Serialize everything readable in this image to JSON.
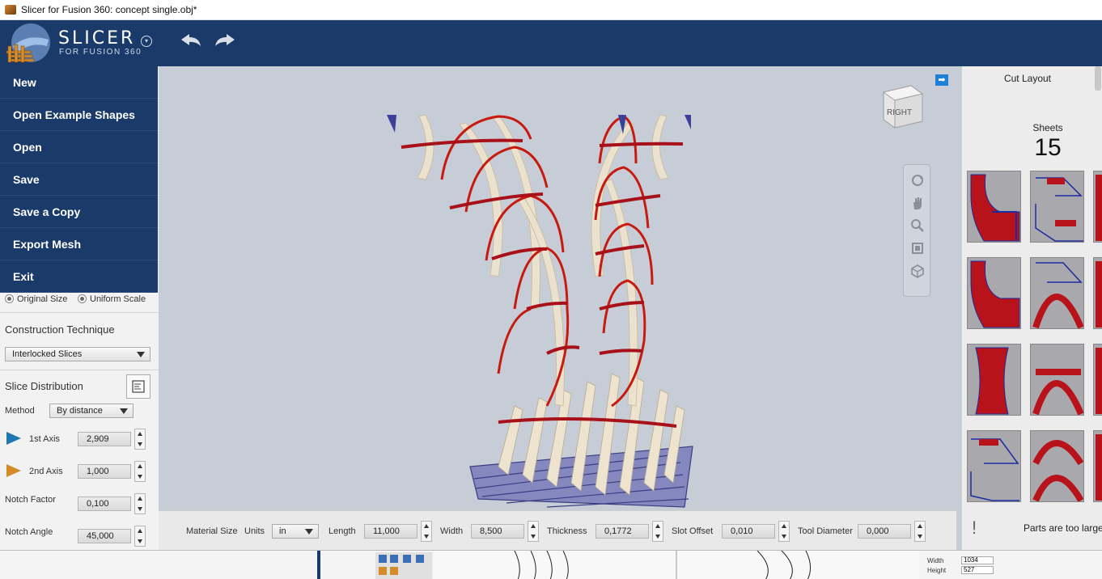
{
  "window": {
    "title": "Slicer for Fusion 360: concept single.obj*"
  },
  "header": {
    "logo_title": "SLICER",
    "logo_subtitle": "FOR FUSION 360"
  },
  "menu": {
    "items": [
      {
        "label": "New"
      },
      {
        "label": "Open Example Shapes"
      },
      {
        "label": "Open"
      },
      {
        "label": "Save"
      },
      {
        "label": "Save a Copy"
      },
      {
        "label": "Export Mesh"
      },
      {
        "label": "Exit"
      }
    ]
  },
  "left_panel": {
    "original_size_label": "Original Size",
    "uniform_scale_label": "Uniform Scale",
    "construction_technique_title": "Construction Technique",
    "construction_technique_value": "Interlocked Slices",
    "slice_distribution_title": "Slice Distribution",
    "method_label": "Method",
    "method_value": "By distance",
    "first_axis_label": "1st Axis",
    "first_axis_value": "2,909",
    "second_axis_label": "2nd Axis",
    "second_axis_value": "1,000",
    "notch_factor_label": "Notch Factor",
    "notch_factor_value": "0,100",
    "notch_angle_label": "Notch Angle",
    "notch_angle_value": "45,000"
  },
  "viewcube": {
    "face_label": "RIGHT"
  },
  "bottom_bar": {
    "material_size_label": "Material Size",
    "units_label": "Units",
    "units_value": "in",
    "length_label": "Length",
    "length_value": "11,000",
    "width_label": "Width",
    "width_value": "8,500",
    "thickness_label": "Thickness",
    "thickness_value": "0,1772",
    "slot_offset_label": "Slot Offset",
    "slot_offset_value": "0,010",
    "tool_diameter_label": "Tool Diameter",
    "tool_diameter_value": "0,000"
  },
  "right_panel": {
    "title": "Cut Layout",
    "sheets_label": "Sheets",
    "sheets_count": "15",
    "warning_text": "Parts are too large"
  },
  "background_app": {
    "width_label": "Width",
    "width_value": "1034",
    "height_label": "Height",
    "height_value": "527"
  },
  "colors": {
    "header_bg": "#1a3a6a",
    "viewport_bg": "#c7cdd6",
    "slice_red": "#c8190f",
    "slice_blue": "#3b3f9a",
    "slice_cream": "#ede3cf"
  },
  "icons": [
    "undo-icon",
    "redo-icon",
    "orbit-icon",
    "pan-icon",
    "zoom-icon",
    "fit-icon",
    "viewcube-home-icon",
    "expand-icon",
    "warning-icon"
  ]
}
